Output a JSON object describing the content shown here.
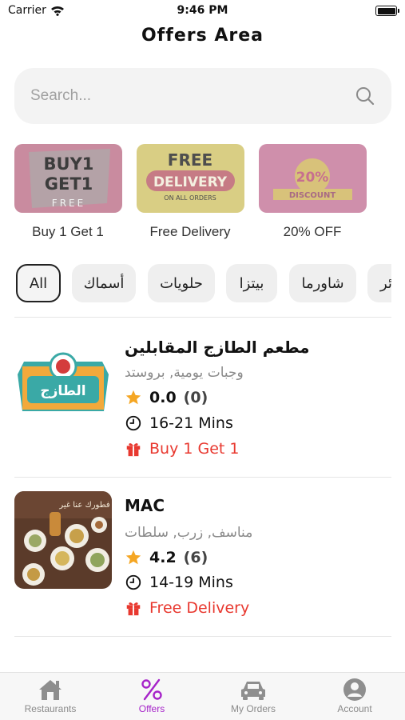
{
  "status_bar": {
    "carrier": "Carrier",
    "time": "9:46 PM"
  },
  "header": {
    "title": "Offers Area"
  },
  "search": {
    "placeholder": "Search..."
  },
  "offers": [
    {
      "label": "Buy 1 Get 1",
      "art_line1": "BUY1",
      "art_line2": "GET1",
      "art_line3": "FREE",
      "color": "#c98b9f"
    },
    {
      "label": "Free Delivery",
      "art_line1": "FREE",
      "art_line2": "DELIVERY",
      "art_line3": "ON ALL ORDERS",
      "color": "#d9ce84"
    },
    {
      "label": "20% OFF",
      "art_line1": "20%",
      "art_line2": "DISCOUNT",
      "color": "#cf8fab"
    }
  ],
  "categories": [
    {
      "label": "All",
      "active": true
    },
    {
      "label": "أسماك"
    },
    {
      "label": "حلويات"
    },
    {
      "label": "بيتزا"
    },
    {
      "label": "شاورما"
    },
    {
      "label": "ئر"
    }
  ],
  "restaurants": [
    {
      "name": "مطعم الطازج المقابلين",
      "cuisine": "وجبات يومية, بروستد",
      "rating": "0.0",
      "rating_count": "(0)",
      "time": "16-21 Mins",
      "offer": "Buy 1 Get 1",
      "logo_text": "الطازج"
    },
    {
      "name": "MAC",
      "cuisine": "مناسف, زرب, سلطات",
      "rating": "4.2",
      "rating_count": "(6)",
      "time": "14-19 Mins",
      "offer": "Free Delivery",
      "logo_text": "فطورك عنا غير"
    }
  ],
  "tabs": [
    {
      "label": "Restaurants",
      "icon": "home-icon"
    },
    {
      "label": "Offers",
      "icon": "percent-icon",
      "active": true
    },
    {
      "label": "My Orders",
      "icon": "car-icon"
    },
    {
      "label": "Account",
      "icon": "account-icon"
    }
  ],
  "colors": {
    "accent": "#a623c9",
    "offer_red": "#e8382f",
    "star": "#f5a623"
  }
}
